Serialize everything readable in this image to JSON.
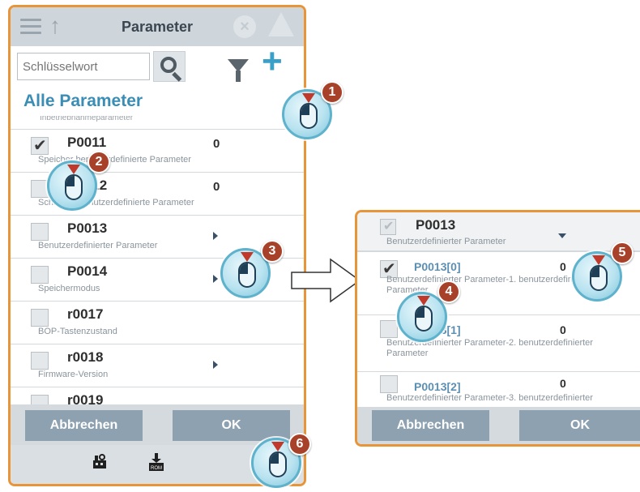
{
  "left": {
    "header_title": "Parameter",
    "search_placeholder": "Schlüsselwort",
    "section_title": "Alle Parameter",
    "cut_text": "Inbetriebnahmeparameter",
    "rows": [
      {
        "id": "P0011",
        "value": "0",
        "desc": "Speicher benutzerdefinierte Parameter",
        "checked": true,
        "arrow": false
      },
      {
        "id": "P0012",
        "value": "0",
        "desc": "Schlüssel benutzerdefinierte Parameter",
        "checked": false,
        "arrow": false
      },
      {
        "id": "P0013",
        "value": "",
        "desc": "Benutzerdefinierter Parameter",
        "checked": false,
        "arrow": true
      },
      {
        "id": "P0014",
        "value": "",
        "desc": "Speichermodus",
        "checked": false,
        "arrow": true
      },
      {
        "id": "r0017",
        "value": "",
        "desc": "BOP-Tastenzustand",
        "checked": false,
        "arrow": false
      },
      {
        "id": "r0018",
        "value": "",
        "desc": "Firmware-Version",
        "checked": false,
        "arrow": true
      },
      {
        "id": "r0019",
        "value": "",
        "desc": "",
        "checked": false,
        "arrow": false
      }
    ],
    "cancel_label": "Abbrechen",
    "ok_label": "OK"
  },
  "right": {
    "header_id": "P0013",
    "header_desc": "Benutzerdefinierter Parameter",
    "rows": [
      {
        "id": "P0013[0]",
        "value": "0",
        "desc": "Benutzerdefinierter Parameter-1. benutzerdefinierter Parameter",
        "checked": true
      },
      {
        "id": "P0013[1]",
        "value": "0",
        "desc": "Benutzerdefinierter Parameter-2. benutzerdefinierter Parameter",
        "checked": false
      },
      {
        "id": "P0013[2]",
        "value": "0",
        "desc": "Benutzerdefinierter Parameter-3. benutzerdefinierter",
        "checked": false
      }
    ],
    "cancel_label": "Abbrechen",
    "ok_label": "OK"
  },
  "callouts": [
    "1",
    "2",
    "3",
    "4",
    "5",
    "6"
  ],
  "icons": {
    "menu": "menu-icon",
    "up": "up-arrow-icon",
    "error": "error-icon",
    "warning": "warning-icon",
    "search": "search-icon",
    "filter": "filter-icon",
    "add": "plus-icon",
    "footer1": "factory-reset-icon",
    "footer2": "save-to-rom-icon",
    "rom_label": "ROM"
  },
  "colors": {
    "panel_border": "#e8953a",
    "accent": "#3a8db4",
    "button": "#8da1b1",
    "callout": "#a8412a"
  }
}
